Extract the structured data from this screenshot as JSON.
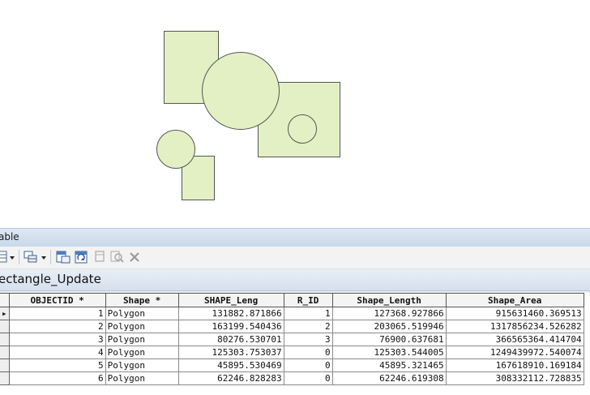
{
  "table_window": {
    "title": "able",
    "tab_label": "ectangle_Update"
  },
  "toolbar_icons": [
    "table-options-icon",
    "dropdown-arrow-icon",
    "related-tables-icon",
    "dropdown-arrow-icon",
    "select-by-attributes-icon",
    "switch-selection-icon",
    "clear-selection-icon",
    "zoom-to-selected-icon",
    "delete-selected-icon"
  ],
  "columns": [
    "OBJECTID *",
    "Shape *",
    "SHAPE_Leng",
    "R_ID",
    "Shape_Length",
    "Shape_Area"
  ],
  "rows": [
    {
      "selector": "▸",
      "objectid": "1",
      "shape": "Polygon",
      "shape_leng": "131882.871866",
      "r_id": "1",
      "shape_length": "127368.927866",
      "shape_area": "915631460.369513"
    },
    {
      "selector": "",
      "objectid": "2",
      "shape": "Polygon",
      "shape_leng": "163199.540436",
      "r_id": "2",
      "shape_length": "203065.519946",
      "shape_area": "1317856234.526282"
    },
    {
      "selector": "",
      "objectid": "3",
      "shape": "Polygon",
      "shape_leng": "80276.530701",
      "r_id": "3",
      "shape_length": "76900.637681",
      "shape_area": "366565364.414704"
    },
    {
      "selector": "",
      "objectid": "4",
      "shape": "Polygon",
      "shape_leng": "125303.753037",
      "r_id": "0",
      "shape_length": "125303.544005",
      "shape_area": "1249439972.540074"
    },
    {
      "selector": "",
      "objectid": "5",
      "shape": "Polygon",
      "shape_leng": "45895.530469",
      "r_id": "0",
      "shape_length": "45895.321465",
      "shape_area": "167618910.169184"
    },
    {
      "selector": "",
      "objectid": "6",
      "shape": "Polygon",
      "shape_leng": "62246.828283",
      "r_id": "0",
      "shape_length": "62246.619308",
      "shape_area": "308332112.728835"
    }
  ],
  "colors": {
    "polygon_fill": "#e3f0c4",
    "polygon_stroke": "#555555",
    "titlebar": "#cfdcec"
  }
}
